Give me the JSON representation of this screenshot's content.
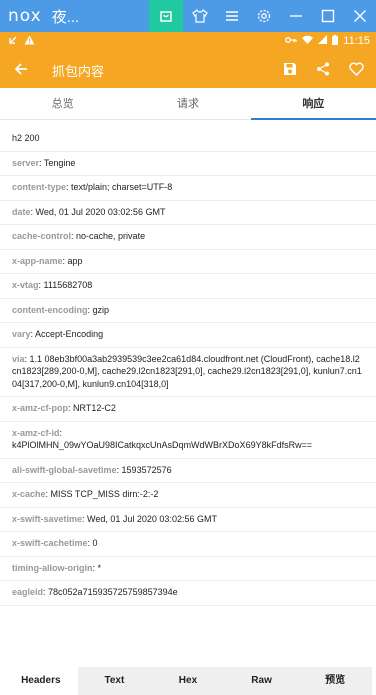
{
  "emulator": {
    "logo": "nox",
    "title": "夜...",
    "icons": [
      "shopping-bag-icon",
      "shirt-icon",
      "menu-icon",
      "gear-icon",
      "minimize-icon",
      "maximize-icon",
      "close-icon"
    ]
  },
  "status_bar": {
    "time": "11:15",
    "icons": [
      "back-arrow-icon",
      "warning-icon",
      "key-icon",
      "wifi-icon",
      "signal-icon",
      "battery-icon"
    ]
  },
  "app_bar": {
    "title": "抓包内容",
    "background": "#f5a623",
    "icons": [
      "back-icon",
      "save-icon",
      "share-icon",
      "heart-icon"
    ]
  },
  "tabs": [
    "总览",
    "请求",
    "响应"
  ],
  "active_tab": "响应",
  "status_line": "h2 200",
  "headers": [
    {
      "key": "server",
      "value": "Tengine"
    },
    {
      "key": "content-type",
      "value": "text/plain; charset=UTF-8"
    },
    {
      "key": "date",
      "value": "Wed, 01 Jul 2020 03:02:56 GMT"
    },
    {
      "key": "cache-control",
      "value": "no-cache, private"
    },
    {
      "key": "x-app-name",
      "value": "app"
    },
    {
      "key": "x-vtag",
      "value": "1115682708"
    },
    {
      "key": "content-encoding",
      "value": "gzip"
    },
    {
      "key": "vary",
      "value": "Accept-Encoding"
    },
    {
      "key": "via",
      "value": "1.1 08eb3bf00a3ab2939539c3ee2ca61d84.cloudfront.net (CloudFront), cache18.l2cn1823[289,200-0,M], cache29.l2cn1823[291,0], cache29.l2cn1823[291,0], kunlun7.cn104[317,200-0,M], kunlun9.cn104[318,0]"
    },
    {
      "key": "x-amz-cf-pop",
      "value": "NRT12-C2"
    },
    {
      "key": "x-amz-cf-id",
      "value": "k4PlOlMHN_09wYOaU98ICatkqxcUnAsDqmWdWBrXDoX69Y8kFdfsRw=="
    },
    {
      "key": "ali-swift-global-savetime",
      "value": "1593572576"
    },
    {
      "key": "x-cache",
      "value": "MISS TCP_MISS dirn:-2:-2"
    },
    {
      "key": "x-swift-savetime",
      "value": "Wed, 01 Jul 2020 03:02:56 GMT"
    },
    {
      "key": "x-swift-cachetime",
      "value": "0"
    },
    {
      "key": "timing-allow-origin",
      "value": "*"
    },
    {
      "key": "eagleid",
      "value": "78c052a715935725759857394e"
    }
  ],
  "bottom_tabs": [
    "Headers",
    "Text",
    "Hex",
    "Raw",
    "预览"
  ],
  "active_bottom_tab": "Headers",
  "colors": {
    "accent": "#f5a623",
    "emulator": "#4d9ae6",
    "tab_indicator": "#2e7dd1"
  }
}
